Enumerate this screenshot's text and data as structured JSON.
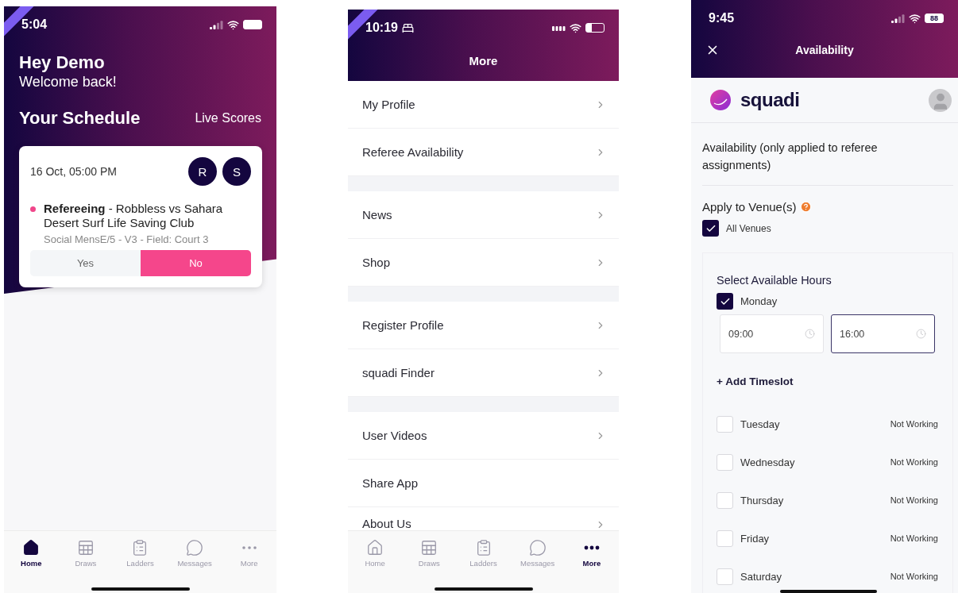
{
  "home": {
    "status_time": "5:04",
    "greeting": "Hey Demo",
    "subtitle": "Welcome back!",
    "section_title": "Your Schedule",
    "link": "Live Scores",
    "card": {
      "date": "16 Oct, 05:00 PM",
      "avatars": [
        "R",
        "S"
      ],
      "marker": {
        "color": "#f0468a"
      },
      "event": "**Refereeing** - Robbless vs Sahara Desert Surf Life Saving Club",
      "detail": "Social MensE/5 - V3 - Field: Court 3",
      "options": [
        {
          "label": "Yes",
          "selected": false
        },
        {
          "label": "No",
          "selected": true
        }
      ]
    },
    "tabs": [
      {
        "kind": "home",
        "label": "Home",
        "selected": true
      },
      {
        "kind": "draws",
        "label": "Draws",
        "selected": false
      },
      {
        "kind": "ladders",
        "label": "Ladders",
        "selected": false
      },
      {
        "kind": "messages",
        "label": "Messages",
        "selected": false
      },
      {
        "kind": "more",
        "label": "More",
        "selected": false
      }
    ]
  },
  "more": {
    "status_time": "10:19",
    "title": "More",
    "groups": [
      [
        {
          "label": "My Profile",
          "chevron": true
        },
        {
          "label": "Referee Availability",
          "chevron": true
        }
      ],
      [
        {
          "label": "News",
          "chevron": true
        },
        {
          "label": "Shop",
          "chevron": true
        }
      ],
      [
        {
          "label": "Register Profile",
          "chevron": true
        },
        {
          "label": "squadi Finder",
          "chevron": true
        }
      ],
      [
        {
          "label": "User Videos",
          "chevron": true
        },
        {
          "label": "Share App",
          "chevron": false
        },
        {
          "label": "About Us",
          "chevron": true
        }
      ]
    ],
    "tabs": [
      {
        "kind": "home",
        "label": "Home",
        "selected": false
      },
      {
        "kind": "draws",
        "label": "Draws",
        "selected": false
      },
      {
        "kind": "ladders",
        "label": "Ladders",
        "selected": false
      },
      {
        "kind": "messages",
        "label": "Messages",
        "selected": false
      },
      {
        "kind": "more",
        "label": "More",
        "selected": true
      }
    ]
  },
  "availability": {
    "status_time": "9:45",
    "battery": "88",
    "title": "Availability",
    "logo_text": "squadi",
    "heading": "Availability (only applied to referee assignments)",
    "venue_label": "Apply to Venue(s)",
    "venue_option": {
      "label": "All Venues",
      "checked": true
    },
    "hours_title": "Select Available Hours",
    "add_link": "+ Add Timeslot",
    "days": [
      {
        "label": "Monday",
        "checked": true,
        "slots": [
          {
            "fields": [
              {
                "value": "09:00",
                "focused": false
              },
              {
                "value": "16:00",
                "focused": true
              }
            ]
          }
        ]
      },
      {
        "label": "Tuesday",
        "checked": false,
        "status": "Not Working"
      },
      {
        "label": "Wednesday",
        "checked": false,
        "status": "Not Working"
      },
      {
        "label": "Thursday",
        "checked": false,
        "status": "Not Working"
      },
      {
        "label": "Friday",
        "checked": false,
        "status": "Not Working"
      },
      {
        "label": "Saturday",
        "checked": false,
        "status": "Not Working"
      }
    ]
  }
}
